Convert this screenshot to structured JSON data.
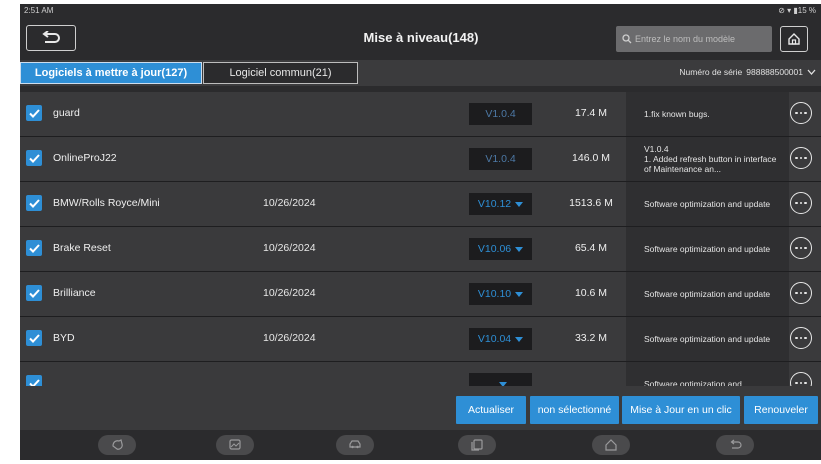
{
  "status": {
    "time": "2:51 AM",
    "icons": "⊘ ▾ ▮15 %"
  },
  "header": {
    "title": "Mise à niveau(148)",
    "search_placeholder": "Entrez le nom du modèle",
    "back_icon": "back-arrow-icon",
    "home_icon": "home-icon"
  },
  "tabs": [
    {
      "label": "Logiciels à mettre à jour(127)",
      "active": true
    },
    {
      "label": "Logiciel commun(21)",
      "active": false
    }
  ],
  "serial": {
    "label": "Numéro de série",
    "value": "988888500001"
  },
  "rows": [
    {
      "name": "guard",
      "date": "",
      "version": "V1.0.4",
      "dropdown": false,
      "size": "17.4 M",
      "desc": "1.fix known bugs."
    },
    {
      "name": "OnlineProJ22",
      "date": "",
      "version": "V1.0.4",
      "dropdown": false,
      "size": "146.0 M",
      "desc": "V1.0.4\n1. Added refresh button in interface of Maintenance an..."
    },
    {
      "name": "BMW/Rolls Royce/Mini",
      "date": "10/26/2024",
      "version": "V10.12",
      "dropdown": true,
      "size": "1513.6 M",
      "desc": "Software optimization and update"
    },
    {
      "name": "Brake Reset",
      "date": "10/26/2024",
      "version": "V10.06",
      "dropdown": true,
      "size": "65.4 M",
      "desc": "Software optimization and update"
    },
    {
      "name": "Brilliance",
      "date": "10/26/2024",
      "version": "V10.10",
      "dropdown": true,
      "size": "10.6 M",
      "desc": "Software optimization and update"
    },
    {
      "name": "BYD",
      "date": "10/26/2024",
      "version": "V10.04",
      "dropdown": true,
      "size": "33.2 M",
      "desc": "Software optimization and update"
    },
    {
      "name": "",
      "date": "",
      "version": "",
      "dropdown": true,
      "size": "",
      "desc": "Software optimization and"
    }
  ],
  "actions": {
    "refresh": "Actualiser",
    "unselected": "non sélectionné",
    "one_click": "Mise à Jour en un clic",
    "renew": "Renouveler"
  },
  "navbar": [
    "diagnose-icon",
    "gallery-icon",
    "vehicle-icon",
    "recent-apps-icon",
    "home-icon",
    "back-icon"
  ],
  "colors": {
    "accent": "#2e8fd6",
    "background": "#2b2b2d",
    "row": "#3a3a3c"
  }
}
